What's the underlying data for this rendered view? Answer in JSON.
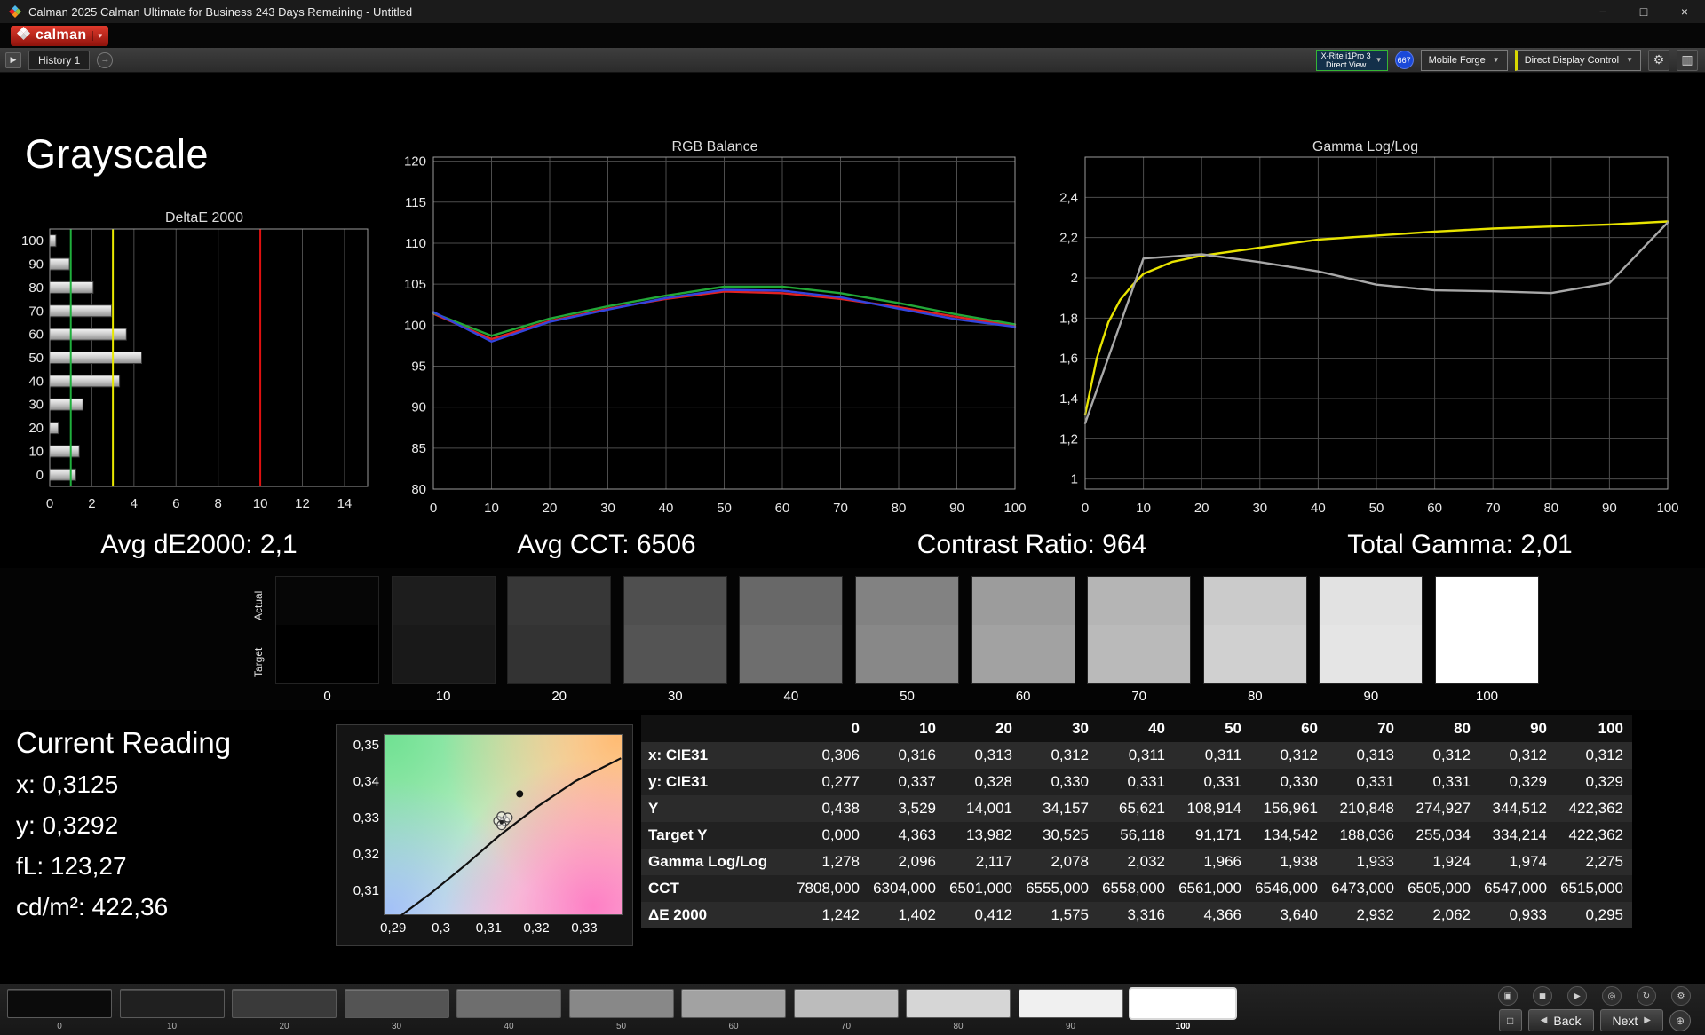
{
  "window": {
    "title": "Calman 2025 Calman Ultimate for Business 243 Days Remaining  - Untitled",
    "minimize_glyph": "−",
    "maximize_glyph": "□",
    "close_glyph": "×"
  },
  "brand": {
    "name": "calman",
    "dropdown_glyph": "▾"
  },
  "toolbar": {
    "history_tab": "History 1",
    "meter_line1": "X-Rite i1Pro 3",
    "meter_line2": "Direct View",
    "meter_badge": "667",
    "workflow_label": "Mobile Forge",
    "display_control_label": "Direct Display Control",
    "gear_glyph": "⚙",
    "panel_glyph": "▥",
    "chevron_glyph": "▼",
    "play_glyph": "▶",
    "nav_glyph": "→"
  },
  "page": {
    "title": "Grayscale",
    "stats": {
      "avg_de": "Avg dE2000: 2,1",
      "avg_cct": "Avg CCT: 6506",
      "contrast": "Contrast Ratio: 964",
      "total_gamma": "Total Gamma: 2,01"
    }
  },
  "swatch_strip": {
    "actual_label": "Actual",
    "target_label": "Target",
    "swatches": [
      {
        "level": "0",
        "actual": "#060606",
        "target": "#000000"
      },
      {
        "level": "10",
        "actual": "#1d1d1d",
        "target": "#191919"
      },
      {
        "level": "20",
        "actual": "#373737",
        "target": "#333333"
      },
      {
        "level": "30",
        "actual": "#4f4f4f",
        "target": "#545454"
      },
      {
        "level": "40",
        "actual": "#686868",
        "target": "#6e6e6e"
      },
      {
        "level": "50",
        "actual": "#828282",
        "target": "#888888"
      },
      {
        "level": "60",
        "actual": "#9c9c9c",
        "target": "#a2a2a2"
      },
      {
        "level": "70",
        "actual": "#b5b5b5",
        "target": "#bababa"
      },
      {
        "level": "80",
        "actual": "#cbcbcb",
        "target": "#d0d0d0"
      },
      {
        "level": "90",
        "actual": "#e2e2e2",
        "target": "#e5e5e5"
      },
      {
        "level": "100",
        "actual": "#ffffff",
        "target": "#ffffff"
      }
    ]
  },
  "current_reading": {
    "title": "Current Reading",
    "x": "x: 0,3125",
    "y": "y: 0,3292",
    "fl": "fL: 123,27",
    "cd": "cd/m²: 422,36"
  },
  "table": {
    "level_headers": [
      "0",
      "10",
      "20",
      "30",
      "40",
      "50",
      "60",
      "70",
      "80",
      "90",
      "100"
    ],
    "rows": [
      {
        "label": "x: CIE31",
        "values": [
          "0,306",
          "0,316",
          "0,313",
          "0,312",
          "0,311",
          "0,311",
          "0,312",
          "0,313",
          "0,312",
          "0,312",
          "0,312"
        ]
      },
      {
        "label": "y: CIE31",
        "values": [
          "0,277",
          "0,337",
          "0,328",
          "0,330",
          "0,331",
          "0,331",
          "0,330",
          "0,331",
          "0,331",
          "0,329",
          "0,329"
        ]
      },
      {
        "label": "Y",
        "values": [
          "0,438",
          "3,529",
          "14,001",
          "34,157",
          "65,621",
          "108,914",
          "156,961",
          "210,848",
          "274,927",
          "344,512",
          "422,362"
        ]
      },
      {
        "label": "Target Y",
        "values": [
          "0,000",
          "4,363",
          "13,982",
          "30,525",
          "56,118",
          "91,171",
          "134,542",
          "188,036",
          "255,034",
          "334,214",
          "422,362"
        ]
      },
      {
        "label": "Gamma Log/Log",
        "values": [
          "1,278",
          "2,096",
          "2,117",
          "2,078",
          "2,032",
          "1,966",
          "1,938",
          "1,933",
          "1,924",
          "1,974",
          "2,275"
        ]
      },
      {
        "label": "CCT",
        "values": [
          "7808,000",
          "6304,000",
          "6501,000",
          "6555,000",
          "6558,000",
          "6561,000",
          "6546,000",
          "6473,000",
          "6505,000",
          "6547,000",
          "6515,000"
        ]
      },
      {
        "label": "ΔE 2000",
        "values": [
          "1,242",
          "1,402",
          "0,412",
          "1,575",
          "3,316",
          "4,366",
          "3,640",
          "2,932",
          "2,062",
          "0,933",
          "0,295"
        ]
      }
    ]
  },
  "chart_data": [
    {
      "type": "bar",
      "title": "DeltaE 2000",
      "orientation": "horizontal",
      "categories": [
        0,
        10,
        20,
        30,
        40,
        50,
        60,
        70,
        80,
        90,
        100
      ],
      "values": [
        1.242,
        1.402,
        0.412,
        1.575,
        3.316,
        4.366,
        3.64,
        2.932,
        2.062,
        0.933,
        0.295
      ],
      "xlim": [
        0,
        15.1
      ],
      "xticks": [
        0,
        2,
        4,
        6,
        8,
        10,
        12,
        14
      ],
      "reference_lines": [
        {
          "x": 1,
          "color": "#1faf3c"
        },
        {
          "x": 3,
          "color": "#e8e800"
        },
        {
          "x": 10,
          "color": "#e01010"
        }
      ]
    },
    {
      "type": "line",
      "title": "RGB Balance",
      "x": [
        0,
        10,
        20,
        30,
        40,
        50,
        60,
        70,
        80,
        90,
        100
      ],
      "xlim": [
        0,
        100
      ],
      "xticks": [
        "0",
        "10",
        "20",
        "30",
        "40",
        "50",
        "60",
        "70",
        "80",
        "90",
        "100"
      ],
      "xtick_values": [
        0,
        10,
        20,
        30,
        40,
        50,
        60,
        70,
        80,
        90,
        100
      ],
      "ylim": [
        80,
        120.5
      ],
      "yticks": [
        "80",
        "85",
        "90",
        "95",
        "100",
        "105",
        "110",
        "115",
        "120"
      ],
      "ytick_values": [
        80,
        85,
        90,
        95,
        100,
        105,
        110,
        115,
        120
      ],
      "series": [
        {
          "name": "red",
          "color": "#e02222",
          "values": [
            101.4,
            98.3,
            100.5,
            102.0,
            103.2,
            104.1,
            103.9,
            103.2,
            102.2,
            101.0,
            99.9
          ]
        },
        {
          "name": "green",
          "color": "#22a838",
          "values": [
            101.5,
            98.7,
            100.8,
            102.3,
            103.6,
            104.7,
            104.7,
            103.9,
            102.7,
            101.3,
            100.1
          ]
        },
        {
          "name": "blue",
          "color": "#3344dd",
          "values": [
            101.6,
            98.0,
            100.4,
            101.9,
            103.3,
            104.3,
            104.2,
            103.4,
            102.0,
            100.7,
            99.8
          ]
        }
      ]
    },
    {
      "type": "line",
      "title": "Gamma Log/Log",
      "x": [
        0,
        10,
        20,
        30,
        40,
        50,
        60,
        70,
        80,
        90,
        100
      ],
      "xlim": [
        0,
        100
      ],
      "xticks": [
        "0",
        "10",
        "20",
        "30",
        "40",
        "50",
        "60",
        "70",
        "80",
        "90",
        "100"
      ],
      "xtick_values": [
        0,
        10,
        20,
        30,
        40,
        50,
        60,
        70,
        80,
        90,
        100
      ],
      "ylim": [
        0.95,
        2.6
      ],
      "yticks": [
        "1",
        "1,2",
        "1,4",
        "1,6",
        "1,8",
        "2",
        "2,2",
        "2,4"
      ],
      "ytick_values": [
        1,
        1.2,
        1.4,
        1.6,
        1.8,
        2,
        2.2,
        2.4
      ],
      "series": [
        {
          "name": "target-gamma",
          "color": "#e8e400",
          "x": [
            0,
            2,
            4,
            6,
            8,
            10,
            15,
            20,
            30,
            40,
            50,
            60,
            70,
            80,
            90,
            100
          ],
          "values": [
            1.32,
            1.6,
            1.78,
            1.89,
            1.96,
            2.02,
            2.08,
            2.11,
            2.15,
            2.19,
            2.21,
            2.23,
            2.245,
            2.255,
            2.265,
            2.28
          ]
        },
        {
          "name": "measured-gamma",
          "color": "#a8a8a8",
          "values": [
            1.278,
            2.096,
            2.117,
            2.078,
            2.032,
            1.966,
            1.938,
            1.933,
            1.924,
            1.974,
            2.275
          ]
        }
      ]
    },
    {
      "type": "scatter",
      "title": "CIE 1931 xy",
      "xlim": [
        0.288,
        0.338
      ],
      "ylim": [
        0.3034,
        0.3532
      ],
      "xticks": [
        "0,29",
        "0,3",
        "0,31",
        "0,32",
        "0,33"
      ],
      "xtick_values": [
        0.29,
        0.3,
        0.31,
        0.32,
        0.33
      ],
      "yticks": [
        "0,35",
        "0,34",
        "0,33",
        "0,32",
        "0,31"
      ],
      "ytick_values": [
        0.35,
        0.34,
        0.33,
        0.32,
        0.31
      ],
      "locus": [
        [
          0.2915,
          0.3036
        ],
        [
          0.298,
          0.31
        ],
        [
          0.305,
          0.3175
        ],
        [
          0.312,
          0.3255
        ],
        [
          0.32,
          0.3335
        ],
        [
          0.328,
          0.3405
        ],
        [
          0.3375,
          0.3468
        ]
      ],
      "measurements": [
        [
          0.3118,
          0.3296
        ],
        [
          0.3132,
          0.3296
        ],
        [
          0.3125,
          0.3308
        ],
        [
          0.3125,
          0.3284
        ],
        [
          0.3138,
          0.3305
        ]
      ],
      "current_point": [
        0.3125,
        0.3292
      ],
      "reference_point": [
        0.3163,
        0.337
      ]
    }
  ],
  "bottom_bar": {
    "patches": [
      {
        "level": "0",
        "color": "#0b0b0b"
      },
      {
        "level": "10",
        "color": "#202020"
      },
      {
        "level": "20",
        "color": "#3a3a3a"
      },
      {
        "level": "30",
        "color": "#545454"
      },
      {
        "level": "40",
        "color": "#6e6e6e"
      },
      {
        "level": "50",
        "color": "#888888"
      },
      {
        "level": "60",
        "color": "#a2a2a2"
      },
      {
        "level": "70",
        "color": "#bcbcbc"
      },
      {
        "level": "80",
        "color": "#d6d6d6"
      },
      {
        "level": "90",
        "color": "#f0f0f0"
      },
      {
        "level": "100",
        "color": "#ffffff"
      }
    ],
    "selected_level": "100",
    "icons": [
      {
        "name": "capture",
        "glyph": "▣"
      },
      {
        "name": "stop",
        "glyph": "◼"
      },
      {
        "name": "play",
        "glyph": "▶"
      },
      {
        "name": "target",
        "glyph": "◎"
      },
      {
        "name": "refresh",
        "glyph": "↻"
      },
      {
        "name": "settings",
        "glyph": "⚙"
      }
    ],
    "pattern_window_glyph": "□",
    "back_label": "Back",
    "next_label": "Next",
    "back_glyph": "◀",
    "next_glyph": "▶",
    "advance_glyph": "⊕"
  }
}
